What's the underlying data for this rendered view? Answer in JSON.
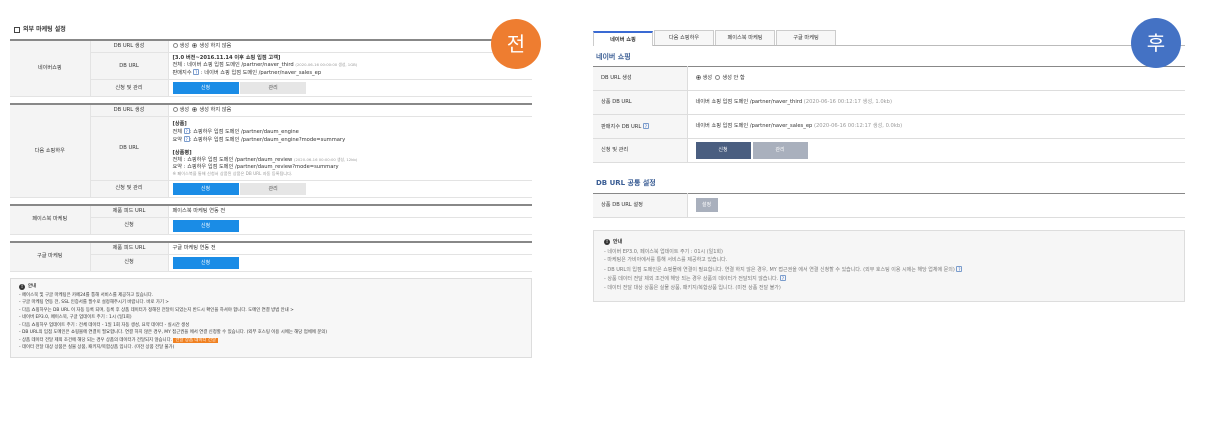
{
  "badges": {
    "before": "전",
    "after": "후"
  },
  "left": {
    "title": "외부 마케팅 설정",
    "naver": {
      "label": "네이버쇼핑",
      "f_url_gen": "DB URL 생성",
      "r_gen": "생성",
      "r_nogen": "생성 하지 않음",
      "f_dburl": "DB URL",
      "dburl_head": "[3.0 버전~2016.11.14 이후 쇼핑 입점 고객]",
      "dburl_all": "전체 : 네이버 쇼핑 입점 도메인 /partner/naver_third",
      "dburl_all_date": "(2020-06-16 00:00:00 생성, 1GB)",
      "dburl_idx": "판매지수",
      "dburl_idx_val": ": 네이버 쇼핑 입점 도메인 /partner/naver_sales_ep",
      "f_apply": "신청 및 관리",
      "btn_apply": "신청",
      "btn_manage": "관리"
    },
    "daum": {
      "label": "다음 쇼핑하우",
      "f_url_gen": "DB URL 생성",
      "r_gen": "생성",
      "r_nogen": "생성 하지 않음",
      "f_dburl": "DB URL",
      "prod_head": "[상품]",
      "prod_all": ": 쇼핑하우 입점 도메인 /partner/daum_engine",
      "prod_sum": ": 쇼핑하우 입점 도메인 /partner/daum_engine?mode=summary",
      "rev_head": "[상품평]",
      "rev_all": "전체 : 쇼핑하우 입점 도메인 /partner/daum_review",
      "rev_all_date": "(2020-06-16 00:00:00 생성, 12kb)",
      "rev_sum": "요약 : 쇼핑하우 입점 도메인 /partner/daum_review?mode=summary",
      "all_label": "전체",
      "sum_label": "요약",
      "note": "※ 페이스북을 통해 신청서 상품된 상품은 DB URL 자동 등록됩니다.",
      "f_apply": "신청 및 관리",
      "btn_apply": "신청",
      "btn_manage": "관리"
    },
    "facebook": {
      "label": "페이스북 마케팅",
      "f_feed": "제품 피드 URL",
      "feed_val": "페이스북 마케팅 연동 전",
      "f_apply": "신청",
      "btn_apply": "신청"
    },
    "google": {
      "label": "구글 마케팅",
      "f_feed": "제품 피드 URL",
      "feed_val": "구글 마케팅 연동 전",
      "f_apply": "신청",
      "btn_apply": "신청"
    },
    "info": {
      "head": "안내",
      "items": [
        "페이스북 및 구글 마케팅은 카페24를 통해 서비스를 제공하고 있습니다.",
        "구글 마케팅 연동 전, SSL 인증서를 필수로 설정해주시기 바랍니다. 바로 가기 >",
        "다음 쇼핑하우는 DB URL 이 자동 등록 되며, 등록 후 상품 데이터가 정해진 전달이 되었는지 반드시 확인을 하셔야 합니다. 도메인 연결 방법 안내 >",
        "네이버 EP3.0, 페이스북, 구글 업데이트 주기 : 1시 (일1회)",
        "다음 쇼핑하우 업데이트 주기 : 전체 데이터 - 1일 1회 자동 생성, 요약 데이터 - 실시간 생성",
        "DB URL의 입점 도메인은 쇼핑몰에 연결이 필요합니다. 연결 하지 않은 경우, MY 접근권을 에서 연결 신청할 수 있습니다. (외부 호스팅 이용 시에는 해당 업체에 문의)",
        "상품 데이터 전달 제외 조건에 해당 되는 경우 상품의 데이터가 전달되지 않습니다.",
        "데이터 전달 대상 상품은 실물 상품, 패키지/복합상품 입니다. (미전 상품 전달 불가)"
      ],
      "tag": "전달 상품 데이터 전달"
    }
  },
  "right": {
    "tabs": [
      "네이버 쇼핑",
      "다음 쇼핑하우",
      "페이스북 마케팅",
      "구글 마케팅"
    ],
    "title": "네이버 쇼핑",
    "rows": {
      "gen_label": "DB URL 생성",
      "r_gen": "생성",
      "r_nogen": "생성 안 함",
      "prod_label": "상품 DB URL",
      "prod_val": "네이버 쇼핑 입점 도메인 /partner/naver_third",
      "prod_date": "(2020-06-16 00:12:17 생성, 1.0kb)",
      "idx_label": "판매지수 DB URL",
      "idx_val": "네이버 쇼핑 입점 도메인 /partner/naver_sales_ep",
      "idx_date": "(2020-06-16 00:12:17 생성, 0.0kb)",
      "apply_label": "신청 및 관리",
      "btn_apply": "신청",
      "btn_manage": "관리"
    },
    "common_title": "DB URL 공통 설정",
    "common_label": "상품 DB URL 설정",
    "common_btn": "설정",
    "info": {
      "head": "안내",
      "items": [
        "네이버 EP3.0, 페이스북 업데이트 주기 : 01시 (일1회)",
        "마케팅은 가비아에서를 통해 서비스를 제공하고 있습니다.",
        "DB URL의 입점 도메인은 쇼핑몰에 연결이 필요합니다. 연결 하지 않은 경우, MY 접근권을 에서 연결 신청할 수 있습니다. (외부 호스팅 이용 시에는 해당 업체에 문의)",
        "상품 데이터 전달 제외 조건에 해당 되는 경우 상품의 데이터가 전달되지 않습니다.",
        "데이터 전달 대상 상품은 실물 상품, 패키지/복합상품 입니다. (미전 상품 전달 불가)"
      ]
    }
  }
}
